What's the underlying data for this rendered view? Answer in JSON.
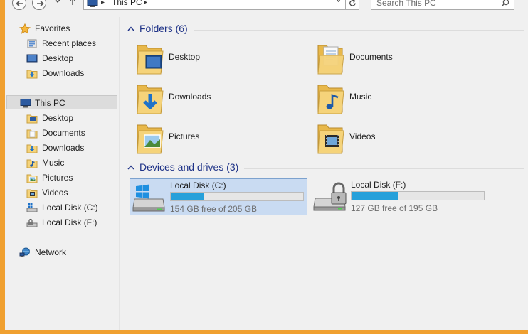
{
  "address": {
    "location": "This PC",
    "separator": "▸"
  },
  "search": {
    "placeholder": "Search This PC"
  },
  "nav": {
    "favorites": {
      "label": "Favorites",
      "items": [
        {
          "label": "Recent places"
        },
        {
          "label": "Desktop"
        },
        {
          "label": "Downloads"
        }
      ]
    },
    "this_pc": {
      "label": "This PC",
      "items": [
        {
          "label": "Desktop"
        },
        {
          "label": "Documents"
        },
        {
          "label": "Downloads"
        },
        {
          "label": "Music"
        },
        {
          "label": "Pictures"
        },
        {
          "label": "Videos"
        },
        {
          "label": "Local Disk (C:)"
        },
        {
          "label": "Local Disk (F:)"
        }
      ]
    },
    "network": {
      "label": "Network"
    }
  },
  "folders": {
    "header": "Folders (6)",
    "items": [
      {
        "label": "Desktop"
      },
      {
        "label": "Documents"
      },
      {
        "label": "Downloads"
      },
      {
        "label": "Music"
      },
      {
        "label": "Pictures"
      },
      {
        "label": "Videos"
      }
    ]
  },
  "drives": {
    "header": "Devices and drives (3)",
    "items": [
      {
        "name": "Local Disk (C:)",
        "free_text": "154 GB free of 205 GB",
        "used_fraction": 0.25,
        "bar_color": "#26a0da"
      },
      {
        "name": "Local Disk (F:)",
        "free_text": "127 GB free of 195 GB",
        "used_fraction": 0.35,
        "bar_color": "#26a0da"
      }
    ]
  },
  "colors": {
    "accent": "#1e3287",
    "selection": "#c9dbf2",
    "folder": "#f5d37a"
  }
}
